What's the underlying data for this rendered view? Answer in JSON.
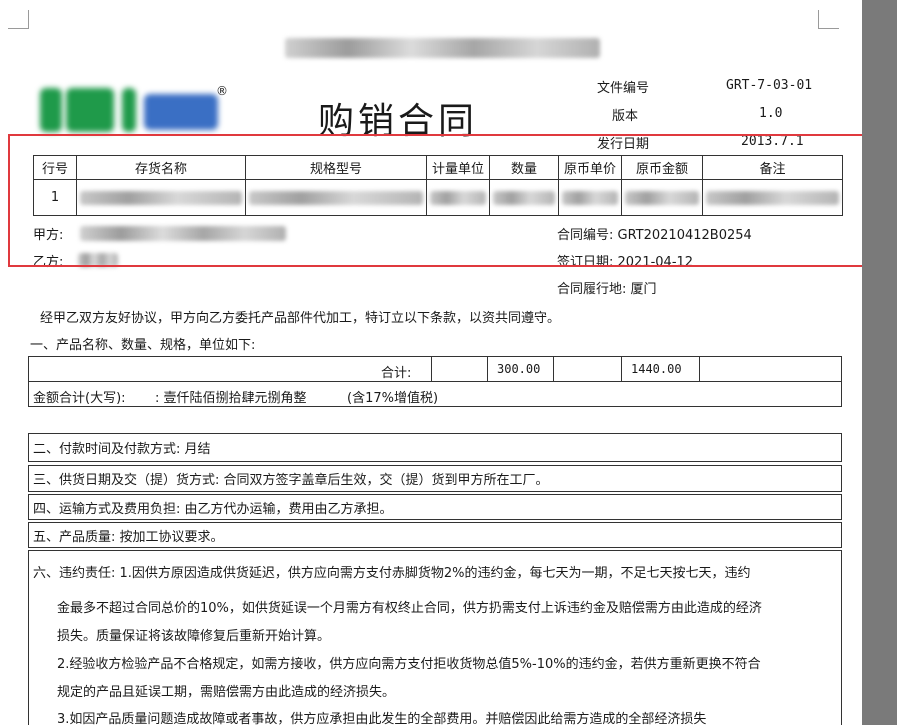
{
  "header": {
    "title": "购销合同",
    "reg_mark": "®",
    "meta": [
      {
        "label": "文件编号",
        "value": "GRT-7-03-01"
      },
      {
        "label": "版本",
        "value": "1.0"
      },
      {
        "label": "发行日期",
        "value": "2013.7.1"
      }
    ]
  },
  "items_table": {
    "columns": [
      "行号",
      "存货名称",
      "规格型号",
      "计量单位",
      "数量",
      "原币单价",
      "原币金额",
      "备注"
    ],
    "rows": [
      {
        "row_no": "1"
      }
    ]
  },
  "parties": {
    "party_a_label": "甲方:",
    "party_b_label": "乙方:",
    "contract_no": "合同编号: GRT20210412B0254",
    "sign_date": "签订日期: 2021-04-12",
    "place": "合同履行地: 厦门"
  },
  "intro": "经甲乙双方友好协议，甲方向乙方委托产品部件代加工，特订立以下条款，以资共同遵守。",
  "section1_title": "一、产品名称、数量、规格，单位如下:",
  "totals": {
    "label": "合计:",
    "quantity": "300.00",
    "amount": "1440.00",
    "amount_words_label": "金额合计(大写):",
    "amount_words": ": 壹仟陆佰捌拾肆元捌角整",
    "tax_note": "(含17%增值税)"
  },
  "terms": {
    "payment": "二、付款时间及付款方式: 月结",
    "delivery": "三、供货日期及交（提）货方式: 合同双方签字盖章后生效，交（提）货到甲方所在工厂。",
    "transport": "四、运输方式及费用负担: 由乙方代办运输，费用由乙方承担。",
    "quality": "五、产品质量: 按加工协议要求。",
    "breach_lines": [
      "六、违约责任: 1.因供方原因造成供货延迟，供方应向需方支付赤脚货物2%的违约金，每七天为一期，不足七天按七天，违约",
      "金最多不超过合同总价的10%，如供货延误一个月需方有权终止合同，供方扔需支付上诉违约金及赔偿需方由此造成的经济",
      "损失。质量保证将该故障修复后重新开始计算。",
      "2.经验收方检验产品不合格规定，如需方接收，供方应向需方支付拒收货物总值5%-10%的违约金，若供方重新更换不符合",
      "规定的产品且延误工期，需赔偿需方由此造成的经济损失。",
      "3.如因产品质量问题造成故障或者事故，供方应承担由此发生的全部费用。并赔偿因此给需方造成的全部经济损失"
    ]
  }
}
